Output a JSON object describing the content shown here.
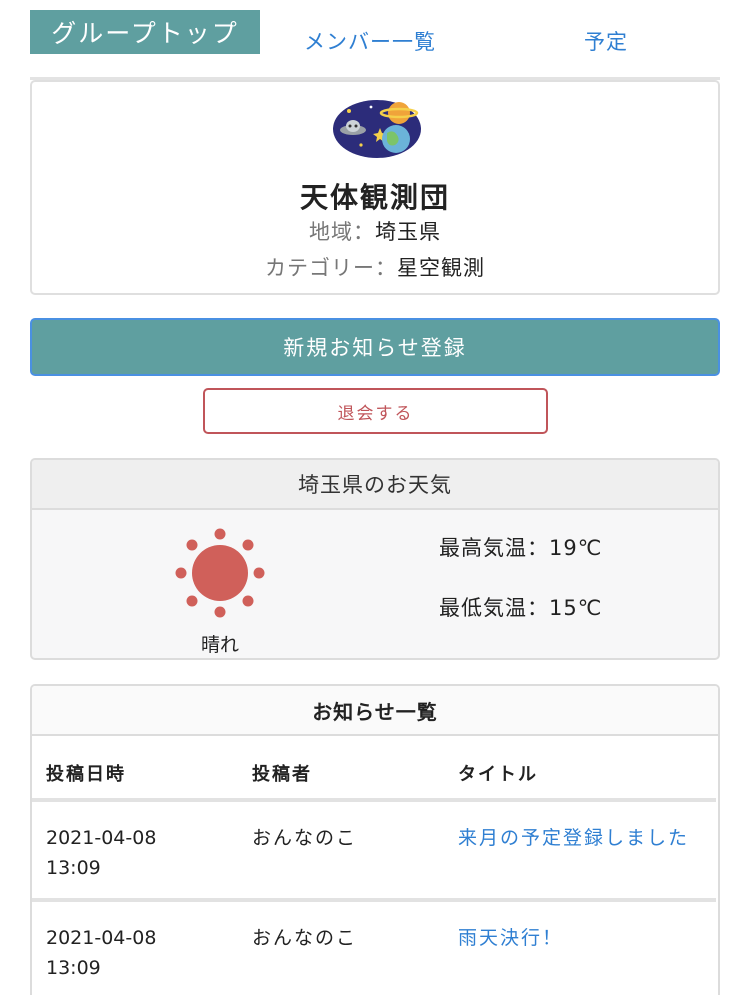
{
  "tabs": {
    "top": "グループトップ",
    "members": "メンバー一覧",
    "schedule": "予定"
  },
  "group": {
    "name": "天体観測団",
    "region_label": "地域：",
    "region_value": "埼玉県",
    "category_label": "カテゴリー：",
    "category_value": "星空観測",
    "logo_icon": "space-planet-ufo-icon"
  },
  "actions": {
    "new_notice": "新規お知らせ登録",
    "leave": "退会する"
  },
  "weather": {
    "heading": "埼玉県のお天気",
    "condition": "晴れ",
    "condition_icon": "sun-icon",
    "high": "最高気温：19℃",
    "low": "最低気温：15℃"
  },
  "notices": {
    "heading": "お知らせ一覧",
    "columns": [
      "投稿日時",
      "投稿者",
      "タイトル"
    ],
    "rows": [
      {
        "date": "2021-04-08",
        "time": "13:09",
        "author": "おんなのこ",
        "title": "来月の予定登録しました"
      },
      {
        "date": "2021-04-08",
        "time": "13:09",
        "author": "おんなのこ",
        "title": "雨天決行！"
      }
    ]
  },
  "colors": {
    "accent_teal": "#5f9fa0",
    "link_blue": "#2f7fd2",
    "danger_red": "#c0555a",
    "sun_red": "#d0605a"
  }
}
